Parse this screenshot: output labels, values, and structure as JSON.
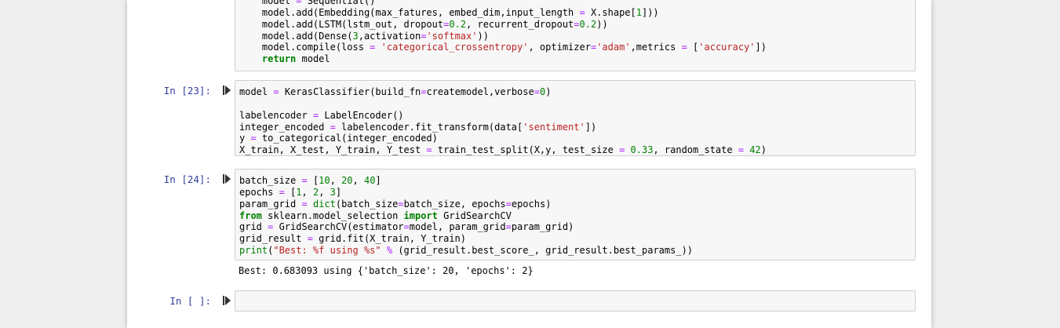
{
  "cells": {
    "top": {
      "lines": [
        "    model = Sequential()",
        "    model.add(Embedding(max_fatures, embed_dim,input_length = X.shape[1]))",
        "    model.add(LSTM(lstm_out, dropout=0.2, recurrent_dropout=0.2))",
        "    model.add(Dense(3,activation='softmax'))",
        "    model.compile(loss = 'categorical_crossentropy', optimizer='adam',metrics = ['accuracy'])",
        "    return model"
      ]
    },
    "cell23": {
      "prompt": "In [23]:",
      "lines": [
        "model = KerasClassifier(build_fn=createmodel,verbose=0)",
        "",
        "labelencoder = LabelEncoder()",
        "integer_encoded = labelencoder.fit_transform(data['sentiment'])",
        "y = to_categorical(integer_encoded)",
        "X_train, X_test, Y_train, Y_test = train_test_split(X,y, test_size = 0.33, random_state = 42)"
      ]
    },
    "cell24": {
      "prompt": "In [24]:",
      "lines": [
        "batch_size = [10, 20, 40]",
        "epochs = [1, 2, 3]",
        "param_grid = dict(batch_size=batch_size, epochs=epochs)",
        "from sklearn.model_selection import GridSearchCV",
        "grid = GridSearchCV(estimator=model, param_grid=param_grid)",
        "grid_result = grid.fit(X_train, Y_train)",
        "print(\"Best: %f using %s\" % (grid_result.best_score_, grid_result.best_params_))"
      ],
      "output": "Best: 0.683093 using {'batch_size': 20, 'epochs': 2}"
    },
    "empty": {
      "prompt": "In [ ]:"
    }
  },
  "colors": {
    "prompt": "#303f9f",
    "keyword": "#008000",
    "string": "#ba2121",
    "number": "#008000",
    "operator": "#aa22ff",
    "cell_bg": "#f7f7f7",
    "cell_border": "#cfcfcf"
  },
  "icons": {
    "run": "run-cell-icon"
  }
}
